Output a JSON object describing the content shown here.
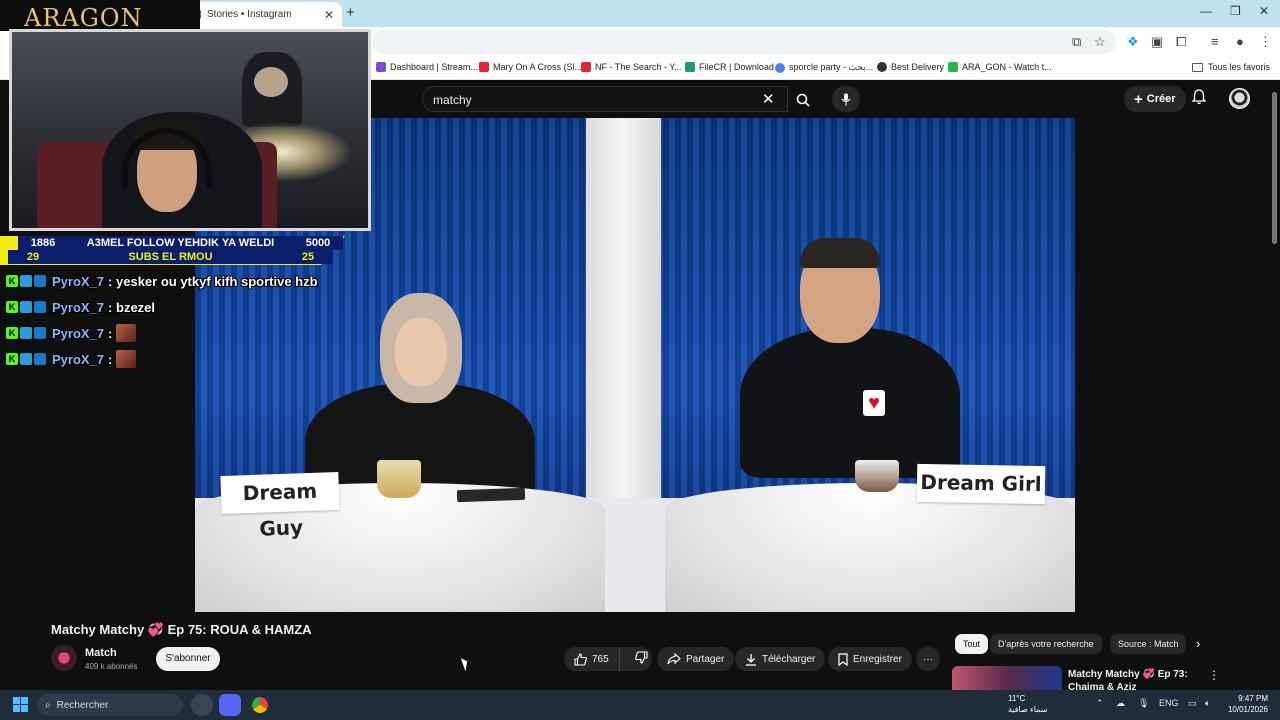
{
  "browser": {
    "tab_title": "Stories • Instagram",
    "bookmarks": [
      {
        "label": "Dashboard | Stream...",
        "color": "#7b4bd6"
      },
      {
        "label": "Mary On A Cross (Sl...",
        "color": "#e5262c"
      },
      {
        "label": "NF - The Search - Y...",
        "color": "#e5262c"
      },
      {
        "label": "FileCR | Download",
        "color": "#1a9b6d"
      },
      {
        "label": "sporcle party - بحث...",
        "color": "#4285f4"
      },
      {
        "label": "Best Delivery",
        "color": "#333333"
      },
      {
        "label": "ARA_GON - Watch t...",
        "color": "#2db34a"
      }
    ],
    "all_bookmarks": "Tous les favoris"
  },
  "youtube": {
    "search_value": "matchy",
    "create_label": "Créer",
    "video_title": "Matchy Matchy 💞 Ep 75: ROUA & HAMZA",
    "channel_name": "Match",
    "subscribers": "409 k abonnés",
    "subscribe_label": "S'abonner",
    "likes": "765",
    "share_label": "Partager",
    "download_label": "Télécharger",
    "save_label": "Enregistrer",
    "chips": [
      "Tout",
      "D'après votre recherche",
      "Source : Match"
    ],
    "rec_title": "Matchy Matchy 💞 Ep 73: Chaima & Aziz",
    "sign_left": "Dream Guy",
    "sign_right": "Dream Girl"
  },
  "overlay": {
    "logo": "ARAGON",
    "counter": {
      "top_left": "1886",
      "top_text": "A3MEL FOLLOW YEHDIK YA WELDI",
      "top_right": "5000",
      "bottom_left": "29",
      "bottom_text": "SUBS EL RMOU",
      "bottom_right": "25"
    },
    "chat": [
      {
        "user": "PyroX_7",
        "message": "yesker ou ytkyf kifh sportive hzb",
        "emote": false
      },
      {
        "user": "PyroX_7",
        "message": "bzezel",
        "emote": false
      },
      {
        "user": "PyroX_7",
        "message": "",
        "emote": true
      },
      {
        "user": "PyroX_7",
        "message": "",
        "emote": true
      }
    ]
  },
  "taskbar": {
    "search_label": "Rechercher",
    "temperature": "11°C",
    "weather_text": "سماء صافية",
    "language": "ENG",
    "time": "9:47 PM",
    "date": "10/01/2026"
  }
}
